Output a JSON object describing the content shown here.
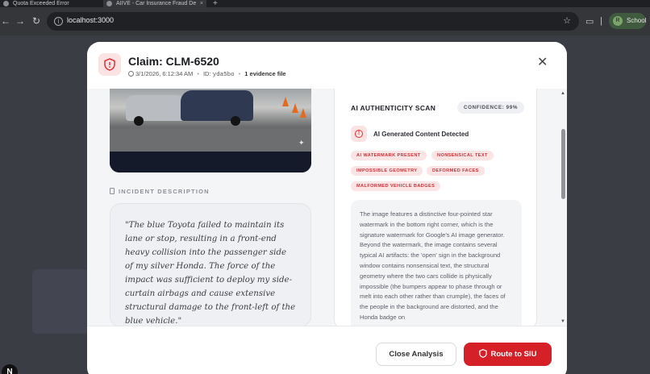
{
  "browser": {
    "tabs": [
      {
        "label": "Quota Exceeded Error"
      },
      {
        "label": "AIIVE - Car Insurance Fraud De"
      }
    ],
    "new_tab": "+",
    "url": "localhost:3000",
    "profile_initial": "R",
    "profile_label": "School"
  },
  "app": {
    "corner_badge": "N"
  },
  "modal": {
    "title": "Claim: CLM-6520",
    "datetime": "3/1/2026, 6:12:34 AM",
    "id_label": "ID:",
    "id_value": "yda5bo",
    "evidence": "1 evidence file",
    "incident_label": "INCIDENT DESCRIPTION",
    "incident_text": "\"The blue Toyota failed to maintain its lane or stop, resulting in a front-end heavy collision into the passenger side of my silver Honda. The force of the impact was sufficient to deploy my side-curtain airbags and cause extensive structural damage to the front-left of the blue vehicle.\"",
    "scan": {
      "title": "AI AUTHENTICITY SCAN",
      "confidence": "CONFIDENCE: 99%",
      "detected": "AI Generated Content Detected",
      "tags": [
        "AI WATERMARK PRESENT",
        "NONSENSICAL TEXT",
        "IMPOSSIBLE GEOMETRY",
        "DEFORMED FACES",
        "MALFORMED VEHICLE BADGES"
      ],
      "analysis": "The image features a distinctive four-pointed star watermark in the bottom right corner, which is the signature watermark for Google's AI image generator. Beyond the watermark, the image contains several typical AI artifacts: the 'open' sign in the background window contains nonsensical text, the structural geometry where the two cars collide is physically impossible (the bumpers appear to phase through or melt into each other rather than crumple), the faces of the people in the background are distorted, and the Honda badge on"
    },
    "buttons": {
      "close": "Close Analysis",
      "route": "Route to SIU"
    }
  },
  "colors": {
    "accent_red": "#d62028",
    "tag_bg": "#fbe4e4",
    "tag_text": "#c7323a"
  }
}
